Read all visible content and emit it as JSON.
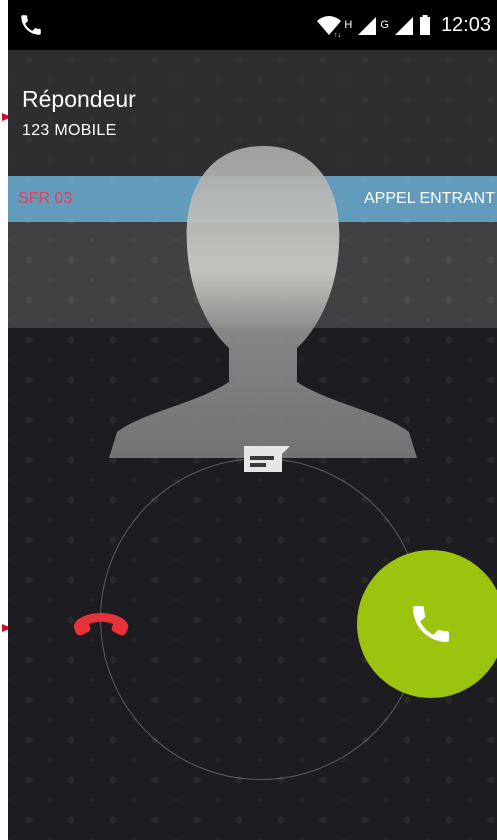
{
  "status_bar": {
    "network_h": "H",
    "network_g": "G",
    "time": "12:03"
  },
  "caller": {
    "name": "Répondeur",
    "number": "123  MOBILE"
  },
  "call_strip": {
    "carrier": "SFR 03",
    "state": "APPEL ENTRANT"
  },
  "icons": {
    "status_phone": "phone-icon",
    "wifi": "wifi-icon",
    "signal": "signal-icon",
    "battery": "battery-icon",
    "avatar": "person-silhouette-icon",
    "sms": "message-icon",
    "decline": "hang-up-icon",
    "answer": "answer-call-icon"
  },
  "colors": {
    "answer": "#9cc40e",
    "decline": "#e8323a",
    "strip": "#6ab0d6",
    "carrier": "#e0405a",
    "marker": "#d0102a"
  }
}
